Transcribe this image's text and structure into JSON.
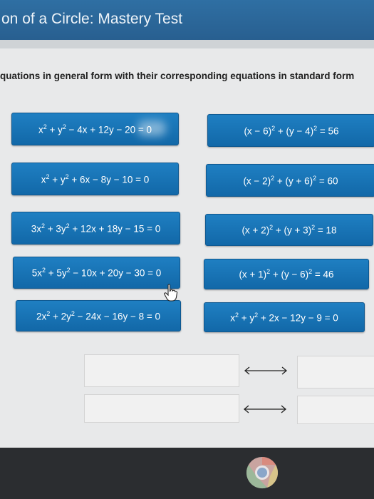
{
  "header": {
    "title": "on of a Circle: Mastery Test"
  },
  "instructions": "quations in general form with their corresponding equations in standard form",
  "left_tiles": [
    {
      "html": "x<sup>2</sup> + y<sup>2</sup> − 4x + 12y − 20 = 0"
    },
    {
      "html": "x<sup>2</sup> + y<sup>2</sup> + 6x − 8y − 10 = 0"
    },
    {
      "html": "3x<sup>2</sup> + 3y<sup>2</sup> + 12x + 18y − 15 = 0"
    },
    {
      "html": "5x<sup>2</sup> + 5y<sup>2</sup> − 10x + 20y − 30 = 0"
    },
    {
      "html": "2x<sup>2</sup> + 2y<sup>2</sup> − 24x − 16y − 8 = 0"
    }
  ],
  "right_tiles": [
    {
      "html": "(x − 6)<sup>2</sup> + (y − 4)<sup>2</sup> = 56"
    },
    {
      "html": "(x − 2)<sup>2</sup> + (y + 6)<sup>2</sup> = 60"
    },
    {
      "html": "(x + 2)<sup>2</sup> + (y + 3)<sup>2</sup> = 18"
    },
    {
      "html": "(x + 1)<sup>2</sup> + (y − 6)<sup>2</sup> = 46"
    },
    {
      "html": "x<sup>2</sup> + y<sup>2</sup> + 2x − 12y − 9 = 0"
    }
  ],
  "icons": {
    "cursor": "hand-pointer-icon",
    "arrow": "double-arrow-icon",
    "taskbar": "chrome-icon"
  },
  "colors": {
    "tile": "#1a74b8",
    "header": "#2c6899"
  }
}
